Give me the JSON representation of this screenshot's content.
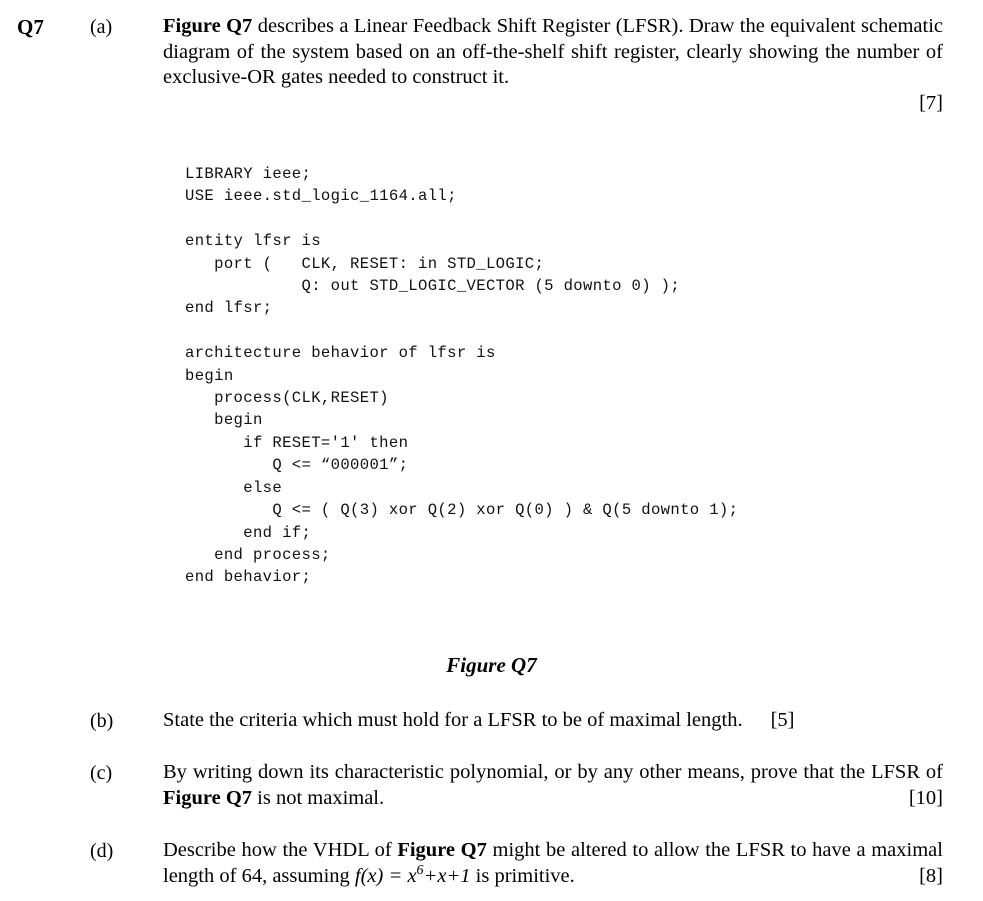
{
  "question": {
    "number": "Q7"
  },
  "parts": [
    {
      "label": "(a)",
      "marks": "[7]",
      "text_lead_bold": "Figure Q7",
      "text_rest": " describes a Linear Feedback Shift Register (LFSR). Draw the equivalent schematic diagram of the system based on an off-the-shelf shift register, clearly showing the number of exclusive-OR gates needed to construct it."
    },
    {
      "label": "(b)",
      "marks": "[5]",
      "text": "State the criteria which must hold for a LFSR to be of maximal length."
    },
    {
      "label": "(c)",
      "marks": "[10]",
      "text_before": "By writing down its characteristic polynomial, or by any other means, prove that the LFSR of ",
      "text_bold": "Figure Q7",
      "text_after": " is not maximal."
    },
    {
      "label": "(d)",
      "marks": "[8]",
      "text_before": "Describe how the VHDL of ",
      "text_bold": "Figure Q7",
      "text_mid": " might be altered to allow the LFSR to have a maximal length of 64, assuming ",
      "formula": {
        "fx": "f(x)",
        "equals": " = ",
        "x": "x",
        "exponent": "6",
        "tail": "+x+1"
      },
      "text_after": " is primitive."
    }
  ],
  "figure": {
    "caption": "Figure Q7",
    "code": "LIBRARY ieee;\nUSE ieee.std_logic_1164.all;\n\nentity lfsr is\n   port (   CLK, RESET: in STD_LOGIC;\n            Q: out STD_LOGIC_VECTOR (5 downto 0) );\nend lfsr;\n\narchitecture behavior of lfsr is\nbegin\n   process(CLK,RESET)\n   begin\n      if RESET='1' then\n         Q <= “000001”;\n      else\n         Q <= ( Q(3) xor Q(2) xor Q(0) ) & Q(5 downto 1);\n      end if;\n   end process;\nend behavior;"
  }
}
